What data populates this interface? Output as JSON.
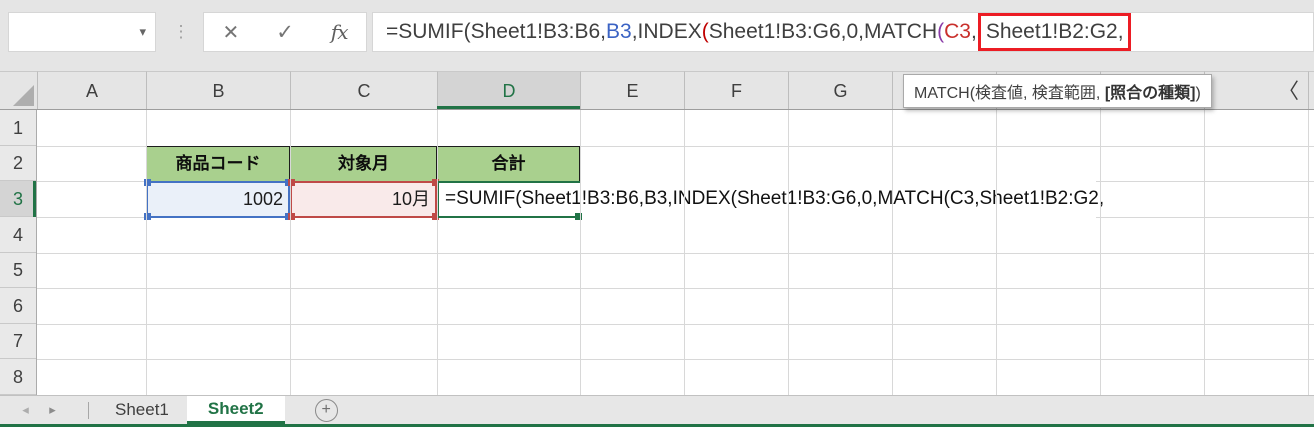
{
  "formula_bar": {
    "name_box_value": "",
    "dropdown_icon": "▾",
    "grip_icon": "⋮",
    "cancel_icon": "✕",
    "enter_icon": "✓",
    "fx_icon": "fx",
    "annotation_box_color": "#EC1C24",
    "segments": [
      {
        "text": "=SUMIF(Sheet1!B3:B6,",
        "color": "#3f3f3f",
        "boxed": false
      },
      {
        "text": "B3",
        "color": "#3b63c4",
        "boxed": false
      },
      {
        "text": ",INDEX",
        "color": "#3f3f3f",
        "boxed": false
      },
      {
        "text": "(",
        "color": "#c00000",
        "boxed": false
      },
      {
        "text": "Sheet1!B3:G6,0,MATCH",
        "color": "#3f3f3f",
        "boxed": false
      },
      {
        "text": "(",
        "color": "#8a3ba8",
        "boxed": false
      },
      {
        "text": "C3",
        "color": "#c9302c",
        "boxed": false
      },
      {
        "text": ",",
        "color": "#3f3f3f",
        "boxed": false
      },
      {
        "text": "Sheet1!B2:G2,",
        "color": "#3f3f3f",
        "boxed": true
      }
    ]
  },
  "function_tooltip": {
    "prefix": "MATCH(検査値, 検査範囲, ",
    "bold_arg": "[照合の種類]",
    "suffix": ")"
  },
  "overflow_mark": "〈",
  "grid": {
    "columns": [
      {
        "label": "A",
        "width": 109,
        "selected": false
      },
      {
        "label": "B",
        "width": 144,
        "selected": false
      },
      {
        "label": "C",
        "width": 147,
        "selected": false
      },
      {
        "label": "D",
        "width": 143,
        "selected": true
      },
      {
        "label": "E",
        "width": 104,
        "selected": false
      },
      {
        "label": "F",
        "width": 104,
        "selected": false
      },
      {
        "label": "G",
        "width": 104,
        "selected": false
      },
      {
        "label": "",
        "width": 104,
        "selected": false
      },
      {
        "label": "",
        "width": 104,
        "selected": false
      },
      {
        "label": "",
        "width": 104,
        "selected": false
      },
      {
        "label": "",
        "width": 104,
        "selected": false
      },
      {
        "label": "",
        "width": 6,
        "selected": false
      }
    ],
    "rows": [
      {
        "label": "1",
        "selected": false
      },
      {
        "label": "2",
        "selected": false
      },
      {
        "label": "3",
        "selected": true
      },
      {
        "label": "4",
        "selected": false
      },
      {
        "label": "5",
        "selected": false
      },
      {
        "label": "6",
        "selected": false
      },
      {
        "label": "7",
        "selected": false
      },
      {
        "label": "8",
        "selected": false
      }
    ]
  },
  "table": {
    "header_fill": "#A9D08E",
    "header_cells": [
      {
        "text": "商品コード"
      },
      {
        "text": "対象月"
      },
      {
        "text": "合計"
      }
    ],
    "product_code_cell": {
      "value": "1002",
      "fill": "#EAF0F9",
      "border_color": "#4472C4"
    },
    "target_month_cell": {
      "value": "10月",
      "fill": "#F9EAEA",
      "border_color": "#BF4A47"
    },
    "total_cell_formula": "=SUMIF(Sheet1!B3:B6,B3,INDEX(Sheet1!B3:G6,0,MATCH(C3,Sheet1!B2:G2,",
    "active_cell_color": "#217346"
  },
  "sheet_tabs": {
    "nav_left_icon": "◂",
    "nav_right_icon": "▸",
    "tabs": [
      {
        "label": "Sheet1",
        "active": false
      },
      {
        "label": "Sheet2",
        "active": true
      }
    ],
    "add_sheet_icon": "+"
  },
  "theme": {
    "excel_green": "#217346"
  }
}
